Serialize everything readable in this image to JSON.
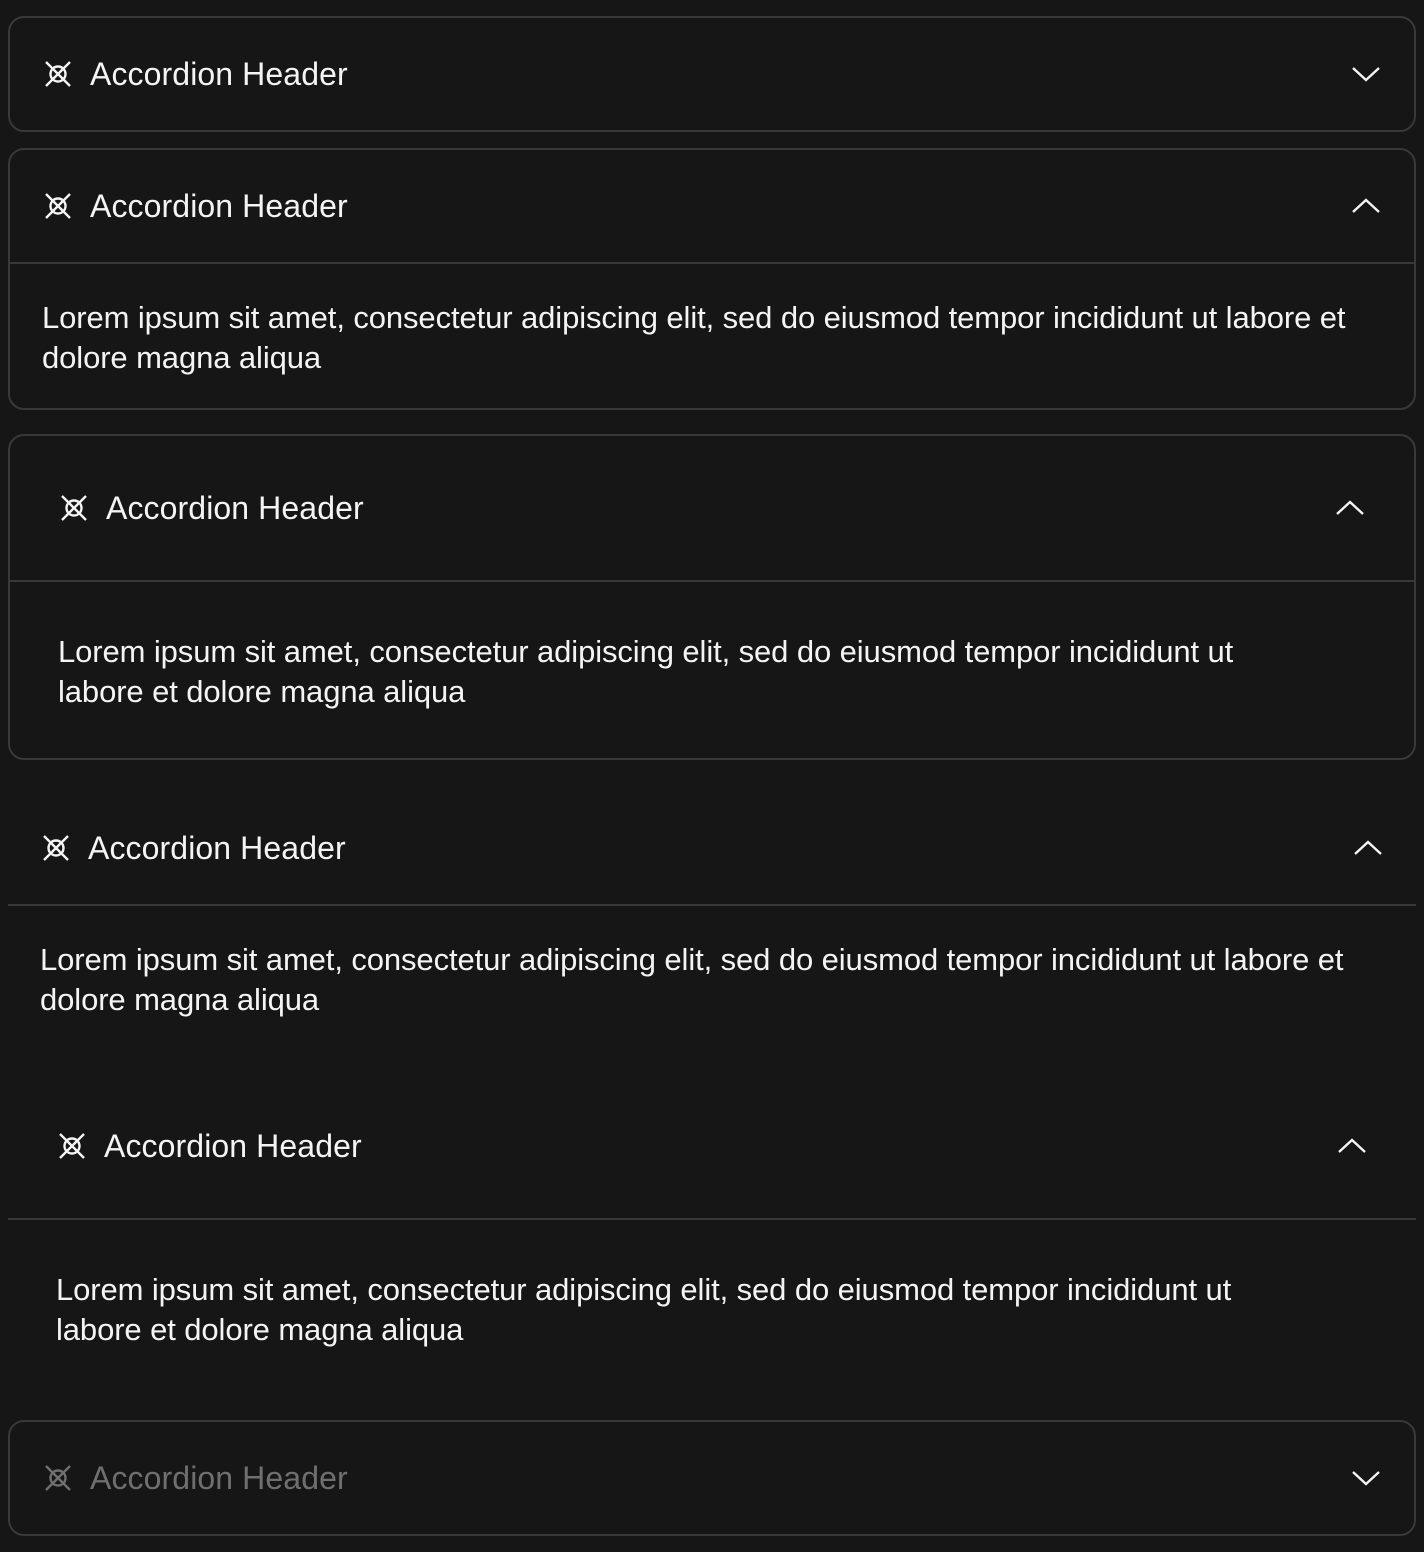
{
  "colors": {
    "background": "#161616",
    "border": "#393939",
    "text": "#f4f4f4",
    "disabled_text": "#6f6f6f"
  },
  "accordions": [
    {
      "header": "Accordion Header",
      "icon": "close-circle-icon",
      "chevron": "chevron-down-icon",
      "expanded": false,
      "disabled": false
    },
    {
      "header": "Accordion Header",
      "icon": "close-circle-icon",
      "chevron": "chevron-up-icon",
      "expanded": true,
      "disabled": false,
      "content": "Lorem ipsum sit amet, consectetur adipiscing elit, sed do eiusmod tempor incididunt ut labore et dolore magna aliqua"
    },
    {
      "header": "Accordion Header",
      "icon": "close-circle-icon",
      "chevron": "chevron-up-icon",
      "expanded": true,
      "disabled": false,
      "content": "Lorem ipsum sit amet, consectetur adipiscing elit, sed do eiusmod tempor incididunt ut labore et dolore magna aliqua"
    },
    {
      "header": "Accordion Header",
      "icon": "close-circle-icon",
      "chevron": "chevron-up-icon",
      "expanded": true,
      "disabled": false,
      "content": "Lorem ipsum sit amet, consectetur adipiscing elit, sed do eiusmod tempor incididunt ut labore et dolore magna aliqua"
    },
    {
      "header": "Accordion Header",
      "icon": "close-circle-icon",
      "chevron": "chevron-up-icon",
      "expanded": true,
      "disabled": false,
      "content": "Lorem ipsum sit amet, consectetur adipiscing elit, sed do eiusmod tempor incididunt ut labore et dolore magna aliqua"
    },
    {
      "header": "Accordion Header",
      "icon": "close-circle-icon",
      "chevron": "chevron-down-icon",
      "expanded": false,
      "disabled": true
    }
  ]
}
